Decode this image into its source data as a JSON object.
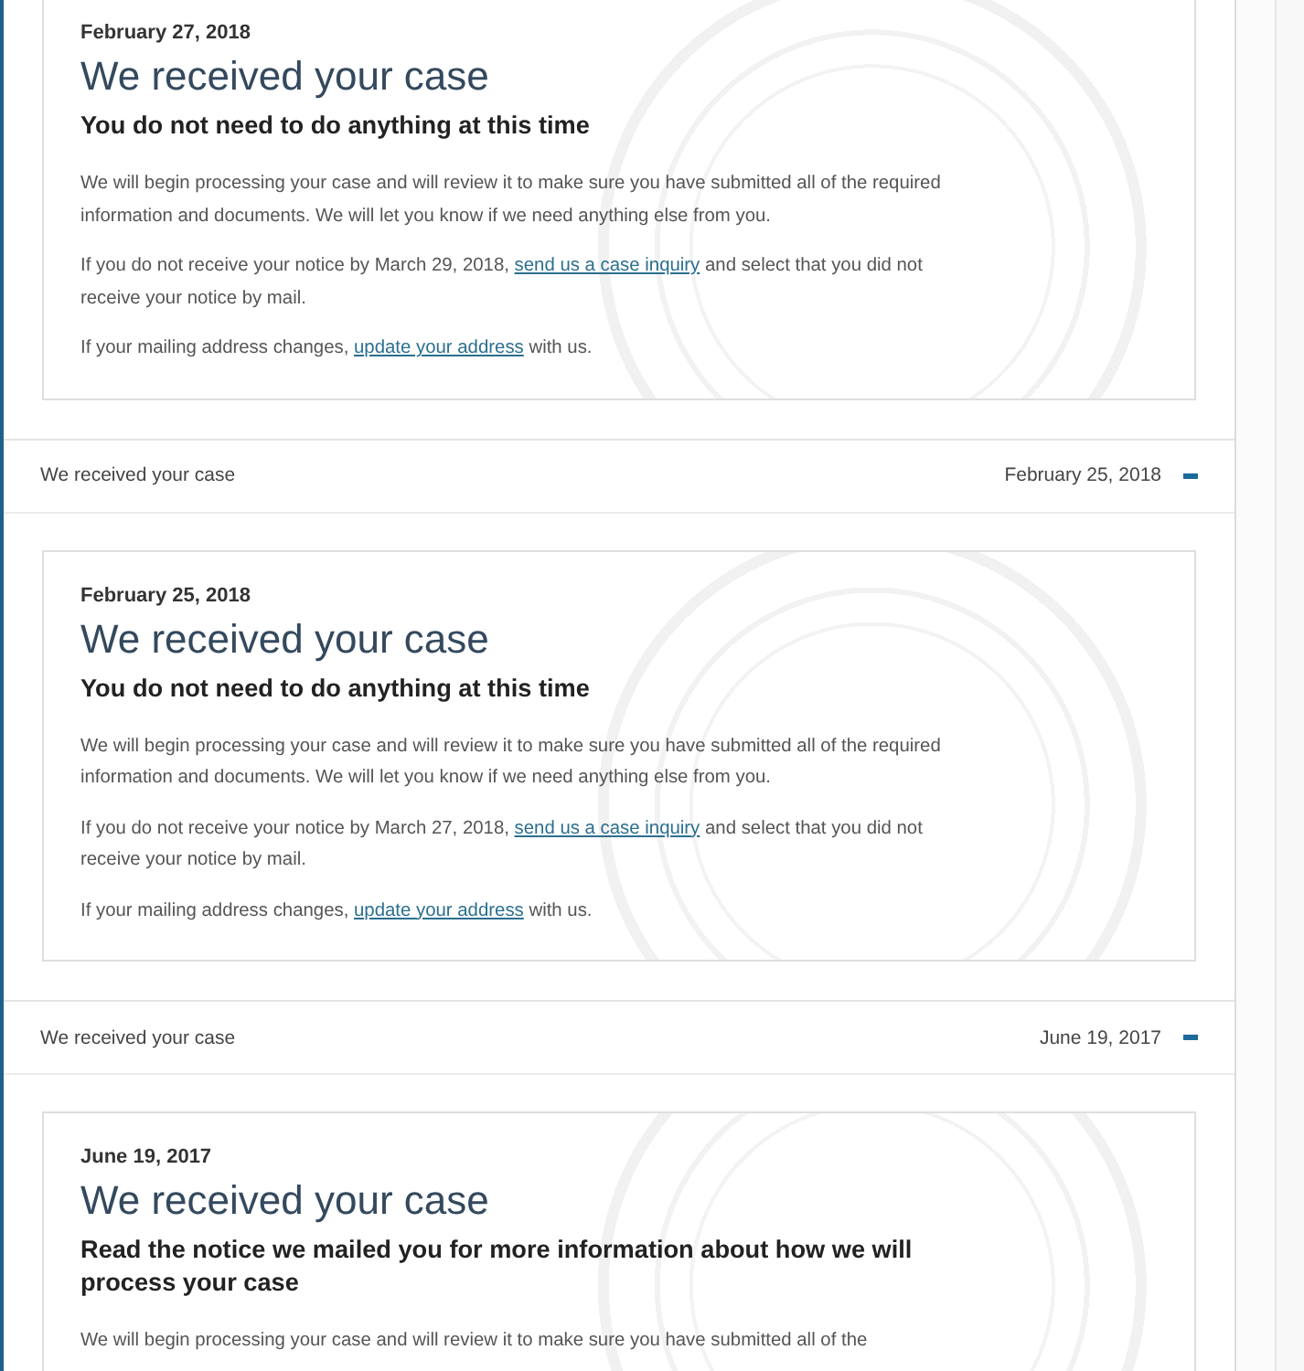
{
  "entries": [
    {
      "card": {
        "date": "February 27, 2018",
        "title": "We received your case",
        "subtitle": "You do not need to do anything at this time",
        "paragraphs": [
          [
            {
              "kind": "text",
              "text": "We will begin processing your case and will review it to make sure you have submitted all of the required information and documents. We will let you know if we need anything else from you."
            }
          ],
          [
            {
              "kind": "text",
              "text": "If you do not receive your notice by March 29, 2018, "
            },
            {
              "kind": "link",
              "text": "send us a case inquiry"
            },
            {
              "kind": "text",
              "text": " and select that you did not receive your notice by mail."
            }
          ],
          [
            {
              "kind": "text",
              "text": "If your mailing address changes, "
            },
            {
              "kind": "link",
              "text": "update your address"
            },
            {
              "kind": "text",
              "text": " with us."
            }
          ]
        ]
      }
    },
    {
      "header": {
        "title": "We received your case",
        "date": "February 25, 2018",
        "expanded": true
      },
      "card": {
        "date": "February 25, 2018",
        "title": "We received your case",
        "subtitle": "You do not need to do anything at this time",
        "paragraphs": [
          [
            {
              "kind": "text",
              "text": "We will begin processing your case and will review it to make sure you have submitted all of the required information and documents. We will let you know if we need anything else from you."
            }
          ],
          [
            {
              "kind": "text",
              "text": "If you do not receive your notice by March 27, 2018, "
            },
            {
              "kind": "link",
              "text": "send us a case inquiry"
            },
            {
              "kind": "text",
              "text": " and select that you did not receive your notice by mail."
            }
          ],
          [
            {
              "kind": "text",
              "text": "If your mailing address changes, "
            },
            {
              "kind": "link",
              "text": "update your address"
            },
            {
              "kind": "text",
              "text": " with us."
            }
          ]
        ]
      }
    },
    {
      "header": {
        "title": "We received your case",
        "date": "June 19, 2017",
        "expanded": true
      },
      "card": {
        "date": "June 19, 2017",
        "title": "We received your case",
        "subtitle": "Read the notice we mailed you for more information about how we will process your case",
        "paragraphs": [
          [
            {
              "kind": "text",
              "text": "We will begin processing your case and will review it to make sure you have submitted all of the"
            }
          ]
        ]
      }
    }
  ]
}
